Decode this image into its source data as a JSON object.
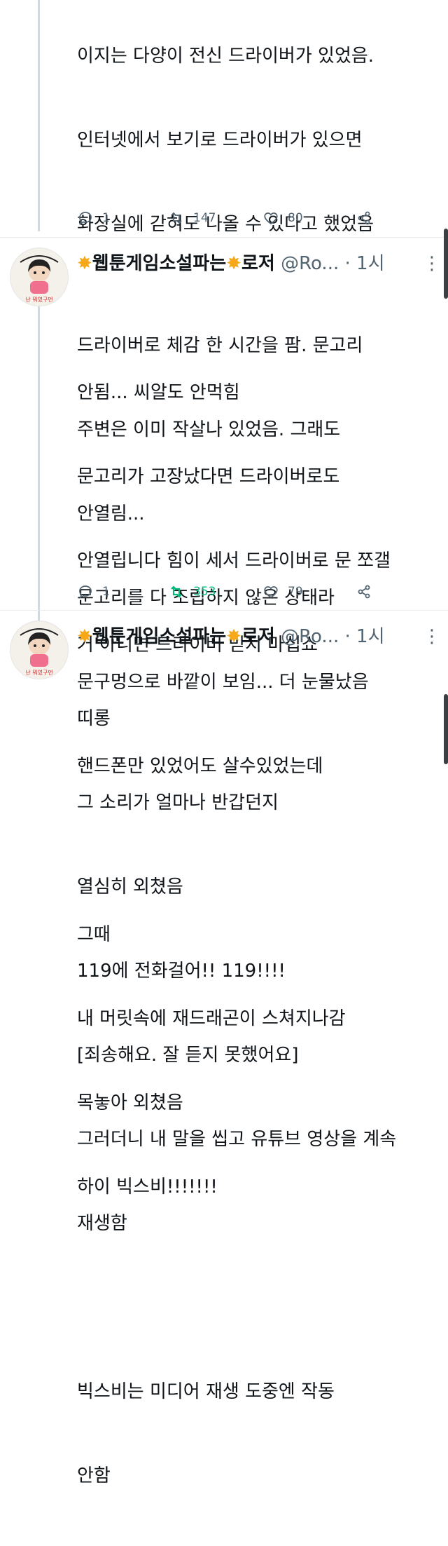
{
  "tweet1": {
    "lines": [
      "이지는 다양이 전신 드라이버가 있었음.",
      "인터넷에서 보기로 드라이버가 있으면",
      "화장실에 갇혀도 나올 수 있다고 했었음",
      "",
      "안됨... 씨알도 안먹힘",
      "문고리가 고장났다면 드라이버로도",
      "안열립니다 힘이 세서 드라이버로 문 쪼갤",
      "거 아니면 드라이버 믿지 마십쇼"
    ],
    "replies": "1",
    "retweets": "147",
    "likes": "80"
  },
  "tweet2": {
    "name": "웹툰게임소설파는",
    "name_suffix": "로저",
    "handle": "@Ro...",
    "time": "· 1시",
    "lines": [
      "드라이버로 체감 한 시간을 팜. 문고리",
      "주변은 이미 작살나 있었음. 그래도",
      "안열림...",
      "문고리를 다 조립하지 않은 상태라",
      "문구멍으로 바깥이 보임... 더 눈물났음",
      "핸드폰만 있었어도 살수있었는데",
      "",
      "그때",
      "내 머릿속에 재드래곤이 스쳐지나감",
      "목놓아 외쳤음",
      "하이 빅스비!!!!!!!"
    ],
    "replies": "1",
    "retweets": "353",
    "likes": "79"
  },
  "tweet3": {
    "name": "웹툰게임소설파는",
    "name_suffix": "로저",
    "handle": "@Ro...",
    "time": "· 1시",
    "lines": [
      "띠롱",
      "그 소리가 얼마나 반갑던지",
      "열심히 외쳤음",
      "119에 전화걸어!! 119!!!!",
      "[죄송해요. 잘 듣지 못했어요]",
      "그러더니 내 말을 씹고 유튜브 영상을 계속",
      "재생함",
      "",
      "빅스비는 미디어 재생 도중엔 작동",
      "안함"
    ]
  },
  "avatar_caption": "난 뭐였구먼",
  "colors": {
    "retweet_active": "#00ba7c",
    "meta": "#536471",
    "thread_line": "#cfd9de"
  }
}
